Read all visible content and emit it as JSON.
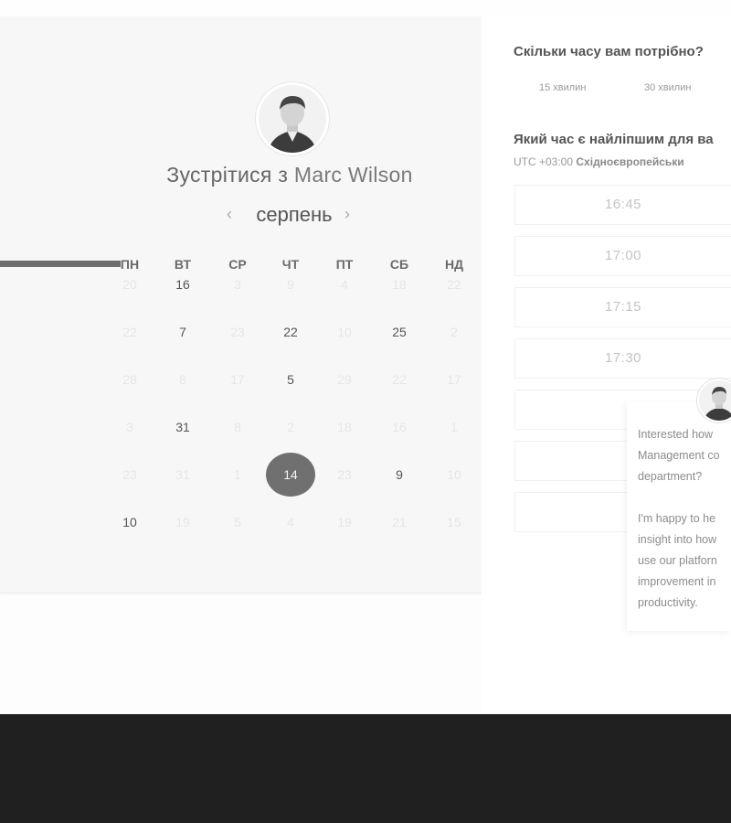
{
  "header": {
    "title_prefix": "Зустрітися з",
    "host_name": "Marc Wilson"
  },
  "calendar": {
    "month": "серпень",
    "prev_arrow": "‹",
    "next_arrow": "›",
    "weekdays": [
      "ПН",
      "ВТ",
      "СР",
      "ЧТ",
      "ПТ",
      "СБ",
      "НД"
    ],
    "weeks": [
      [
        {
          "d": "20",
          "a": false
        },
        {
          "d": "16",
          "a": true
        },
        {
          "d": "3",
          "a": false
        },
        {
          "d": "9",
          "a": false
        },
        {
          "d": "4",
          "a": false
        },
        {
          "d": "18",
          "a": false
        },
        {
          "d": "22",
          "a": false
        }
      ],
      [
        {
          "d": "22",
          "a": false
        },
        {
          "d": "7",
          "a": true
        },
        {
          "d": "23",
          "a": false
        },
        {
          "d": "22",
          "a": true
        },
        {
          "d": "10",
          "a": false
        },
        {
          "d": "25",
          "a": true
        },
        {
          "d": "2",
          "a": false
        }
      ],
      [
        {
          "d": "28",
          "a": false
        },
        {
          "d": "8",
          "a": false
        },
        {
          "d": "17",
          "a": false
        },
        {
          "d": "5",
          "a": true
        },
        {
          "d": "29",
          "a": false
        },
        {
          "d": "22",
          "a": false
        },
        {
          "d": "17",
          "a": false
        }
      ],
      [
        {
          "d": "3",
          "a": false
        },
        {
          "d": "31",
          "a": true
        },
        {
          "d": "8",
          "a": false
        },
        {
          "d": "2",
          "a": false
        },
        {
          "d": "18",
          "a": false
        },
        {
          "d": "16",
          "a": false
        },
        {
          "d": "1",
          "a": false
        }
      ],
      [
        {
          "d": "23",
          "a": false
        },
        {
          "d": "31",
          "a": false
        },
        {
          "d": "1",
          "a": false
        },
        {
          "d": "14",
          "a": true,
          "selected": true
        },
        {
          "d": "23",
          "a": false
        },
        {
          "d": "9",
          "a": true
        },
        {
          "d": "10",
          "a": false
        }
      ],
      [
        {
          "d": "10",
          "a": true
        },
        {
          "d": "19",
          "a": false
        },
        {
          "d": "5",
          "a": false
        },
        {
          "d": "4",
          "a": false
        },
        {
          "d": "19",
          "a": false
        },
        {
          "d": "21",
          "a": false
        },
        {
          "d": "15",
          "a": false
        }
      ]
    ]
  },
  "booking": {
    "duration_question": "Скільки часу вам потрібно?",
    "durations": [
      "15 хвилин",
      "30 хвилин"
    ],
    "time_question": "Який час є найліпшим для ва",
    "timezone_offset": "UTC +03:00",
    "timezone_name": "Східноєвропейськи",
    "time_slots": [
      "16:45",
      "17:00",
      "17:15",
      "17:30",
      "",
      "",
      ""
    ]
  },
  "chat": {
    "lines": [
      "Interested how",
      "Management co",
      "department?",
      "",
      "I'm happy to he",
      "insight into how",
      "use our platforn",
      "improvement in",
      "productivity."
    ]
  },
  "colors": {
    "selected_day": "#707070",
    "footer": "#202020",
    "panel": "#f7f7f7"
  }
}
